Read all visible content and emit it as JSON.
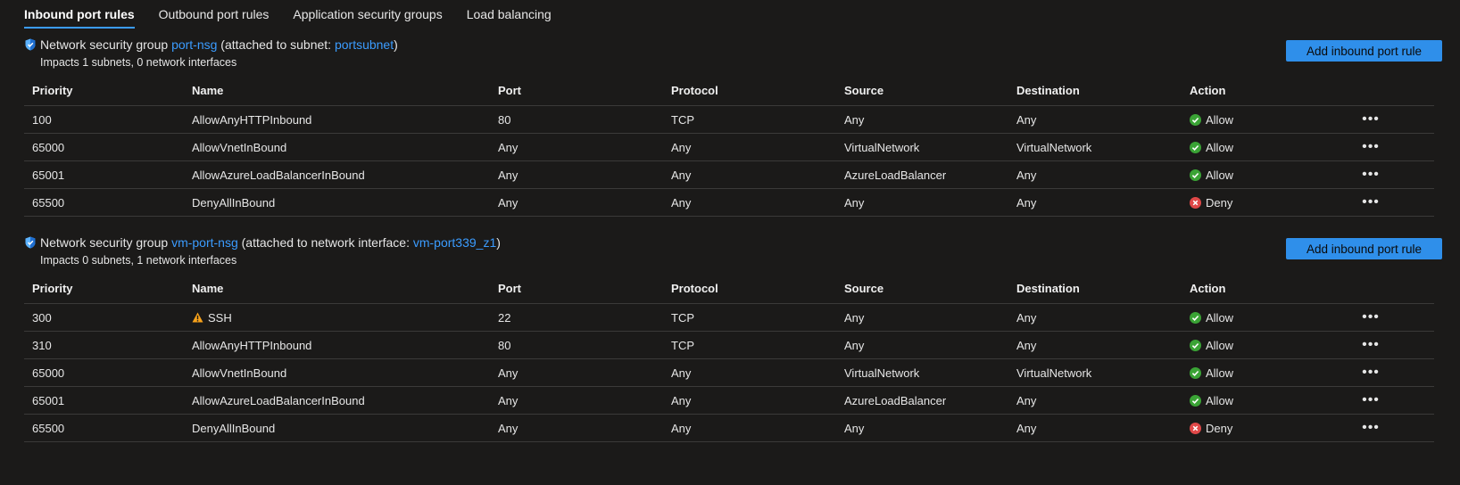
{
  "tabs": [
    {
      "label": "Inbound port rules",
      "active": true
    },
    {
      "label": "Outbound port rules",
      "active": false
    },
    {
      "label": "Application security groups",
      "active": false
    },
    {
      "label": "Load balancing",
      "active": false
    }
  ],
  "columns": [
    "Priority",
    "Name",
    "Port",
    "Protocol",
    "Source",
    "Destination",
    "Action"
  ],
  "colors": {
    "accent": "#3b9cff",
    "button": "#2f8fea",
    "allow": "#3aa335",
    "deny": "#e04848",
    "warning": "#f7a21b"
  },
  "groups": [
    {
      "prefix": "Network security group",
      "nsg_name": "port-nsg",
      "middle": "(attached to subnet:",
      "attached_name": "portsubnet",
      "suffix": ")",
      "impacts": "Impacts 1 subnets, 0 network interfaces",
      "add_button": "Add inbound port rule",
      "rules": [
        {
          "priority": "100",
          "name": "AllowAnyHTTPInbound",
          "warning": false,
          "port": "80",
          "protocol": "TCP",
          "source": "Any",
          "destination": "Any",
          "action": "Allow"
        },
        {
          "priority": "65000",
          "name": "AllowVnetInBound",
          "warning": false,
          "port": "Any",
          "protocol": "Any",
          "source": "VirtualNetwork",
          "destination": "VirtualNetwork",
          "action": "Allow"
        },
        {
          "priority": "65001",
          "name": "AllowAzureLoadBalancerInBound",
          "warning": false,
          "port": "Any",
          "protocol": "Any",
          "source": "AzureLoadBalancer",
          "destination": "Any",
          "action": "Allow"
        },
        {
          "priority": "65500",
          "name": "DenyAllInBound",
          "warning": false,
          "port": "Any",
          "protocol": "Any",
          "source": "Any",
          "destination": "Any",
          "action": "Deny"
        }
      ]
    },
    {
      "prefix": "Network security group",
      "nsg_name": "vm-port-nsg",
      "middle": "(attached to network interface:",
      "attached_name": "vm-port339_z1",
      "suffix": ")",
      "impacts": "Impacts 0 subnets, 1 network interfaces",
      "add_button": "Add inbound port rule",
      "rules": [
        {
          "priority": "300",
          "name": "SSH",
          "warning": true,
          "port": "22",
          "protocol": "TCP",
          "source": "Any",
          "destination": "Any",
          "action": "Allow"
        },
        {
          "priority": "310",
          "name": "AllowAnyHTTPInbound",
          "warning": false,
          "port": "80",
          "protocol": "TCP",
          "source": "Any",
          "destination": "Any",
          "action": "Allow"
        },
        {
          "priority": "65000",
          "name": "AllowVnetInBound",
          "warning": false,
          "port": "Any",
          "protocol": "Any",
          "source": "VirtualNetwork",
          "destination": "VirtualNetwork",
          "action": "Allow"
        },
        {
          "priority": "65001",
          "name": "AllowAzureLoadBalancerInBound",
          "warning": false,
          "port": "Any",
          "protocol": "Any",
          "source": "AzureLoadBalancer",
          "destination": "Any",
          "action": "Allow"
        },
        {
          "priority": "65500",
          "name": "DenyAllInBound",
          "warning": false,
          "port": "Any",
          "protocol": "Any",
          "source": "Any",
          "destination": "Any",
          "action": "Deny"
        }
      ]
    }
  ],
  "icons": {
    "shield": "shield-icon",
    "allow": "check-circle-icon",
    "deny": "x-circle-icon",
    "warning": "warning-triangle-icon",
    "more": "more-icon"
  },
  "more_glyph": "•••"
}
